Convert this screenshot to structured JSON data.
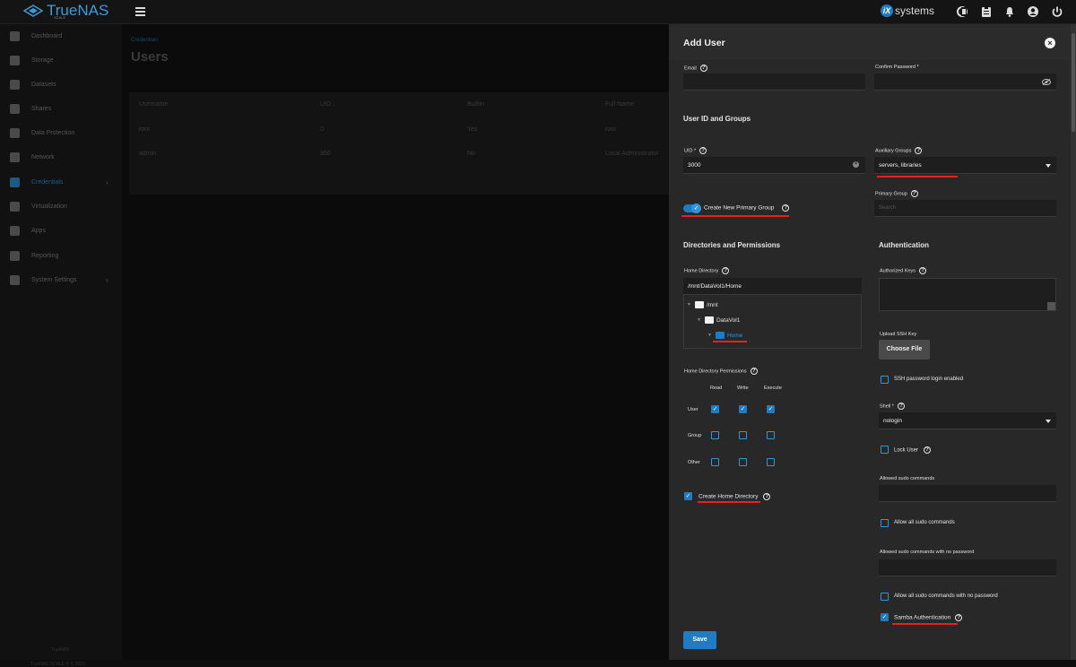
{
  "app": {
    "logo_text": "TrueNAS",
    "logo_sub": "SCALE",
    "brand": "systems",
    "brand_badge": "iX"
  },
  "sidebar": {
    "items": [
      {
        "label": "Dashboard"
      },
      {
        "label": "Storage"
      },
      {
        "label": "Datasets"
      },
      {
        "label": "Shares"
      },
      {
        "label": "Data Protection"
      },
      {
        "label": "Network"
      },
      {
        "label": "Credentials"
      },
      {
        "label": "Virtualization"
      },
      {
        "label": "Apps"
      },
      {
        "label": "Reporting"
      },
      {
        "label": "System Settings"
      }
    ],
    "footer_1": "TrueNAS",
    "footer_2": "TrueNAS SCALE ® © 2023"
  },
  "main": {
    "breadcrumb": "Credentials",
    "title": "Users",
    "table": {
      "headers": [
        "Username",
        "UID ↓",
        "Builtin",
        "Full Name"
      ],
      "rows": [
        [
          "root",
          "0",
          "Yes",
          "root"
        ],
        [
          "admin",
          "950",
          "No",
          "Local Administrator"
        ]
      ]
    }
  },
  "panel": {
    "title": "Add User",
    "close_icon": "×",
    "email_label": "Email",
    "confirm_password_label": "Confirm Password *",
    "section_ids": "User ID and Groups",
    "uid_label": "UID *",
    "uid_value": "3000",
    "aux_groups_label": "Auxiliary Groups",
    "aux_groups_value": "servers, libraries",
    "create_primary_group_label": "Create New Primary Group",
    "primary_group_label": "Primary Group",
    "primary_group_placeholder": "Search",
    "section_dirs": "Directories and Permissions",
    "home_dir_label": "Home Directory",
    "home_dir_value": "/mnt/DataVol1/Home",
    "tree": [
      "/mnt",
      "DataVol1",
      "Home"
    ],
    "home_perm_label": "Home Directory Permissions",
    "perm_cols": [
      "Read",
      "Write",
      "Execute"
    ],
    "perm_rows": [
      "User",
      "Group",
      "Other"
    ],
    "create_home_dir_label": "Create Home Directory",
    "section_auth": "Authentication",
    "auth_keys_label": "Authorized Keys",
    "upload_ssh_label": "Upload SSH Key",
    "choose_file_label": "Choose File",
    "ssh_pw_label": "SSH password login enabled",
    "shell_label": "Shell *",
    "shell_value": "nologin",
    "lock_user_label": "Lock User",
    "sudo_cmds_label": "Allowed sudo commands",
    "allow_all_sudo_label": "Allow all sudo commands",
    "sudo_nopw_label": "Allowed sudo commands with no password",
    "allow_all_sudo_nopw_label": "Allow all sudo commands with no password",
    "samba_label": "Samba Authentication",
    "save_label": "Save"
  },
  "colors": {
    "accent": "#1f7bc2",
    "annotation": "#e8201e",
    "panel_bg": "#282828"
  }
}
